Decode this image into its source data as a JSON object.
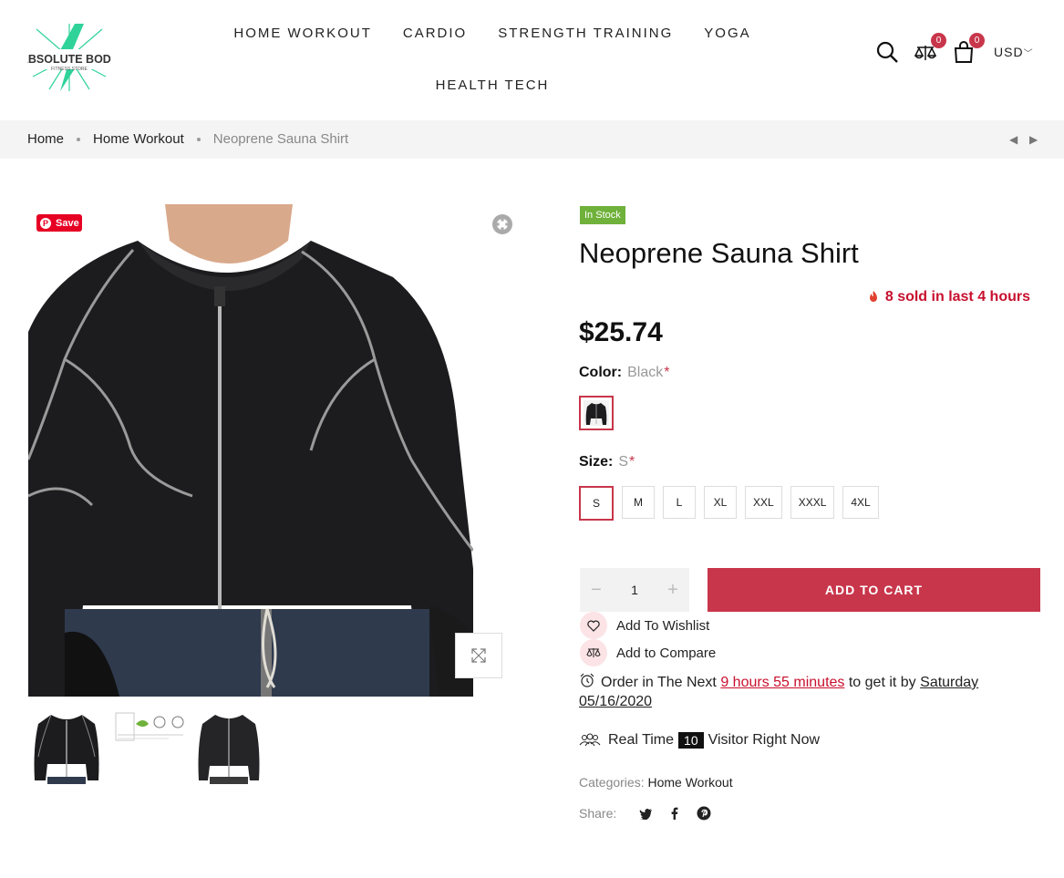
{
  "header": {
    "logo_text": "ABSOLUTE BODY",
    "logo_sub": "FITNESS STORE",
    "nav": [
      "HOME WORKOUT",
      "CARDIO",
      "STRENGTH TRAINING",
      "YOGA",
      "HEALTH TECH"
    ],
    "compare_count": "0",
    "cart_count": "0",
    "currency": "USD"
  },
  "breadcrumb": {
    "items": [
      "Home",
      "Home Workout",
      "Neoprene Sauna Shirt"
    ]
  },
  "gallery": {
    "pin_label": "Save",
    "thumbnails": [
      "thumb-front",
      "thumb-info",
      "thumb-front-2"
    ]
  },
  "product": {
    "stock": "In Stock",
    "title": "Neoprene Sauna Shirt",
    "sold_text": "8 sold in last 4 hours",
    "price": "$25.74",
    "color_label": "Color:",
    "color_value": "Black",
    "size_label": "Size:",
    "size_value": "S",
    "required_mark": "*",
    "sizes": [
      "S",
      "M",
      "L",
      "XL",
      "XXL",
      "XXXL",
      "4XL"
    ],
    "selected_size": "S",
    "quantity": "1",
    "add_to_cart": "ADD TO CART",
    "wishlist": "Add To Wishlist",
    "compare": "Add to Compare",
    "order_prefix": "Order in The Next",
    "order_time": "9 hours 55 minutes",
    "order_mid": "to get it by",
    "order_date": "Saturday 05/16/2020",
    "visitors_prefix": "Real Time",
    "visitors_count": "10",
    "visitors_suffix": "Visitor Right Now",
    "categories_label": "Categories:",
    "category": "Home Workout",
    "share_label": "Share:"
  },
  "colors": {
    "accent": "#c8364b",
    "in_stock": "#6fb13a",
    "hot": "#c8102e",
    "logo_green": "#2fd39a"
  }
}
